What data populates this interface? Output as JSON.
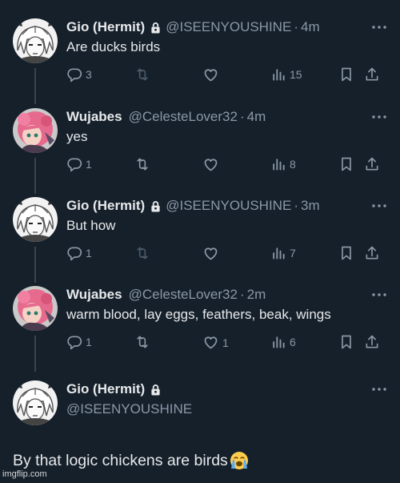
{
  "tweets": [
    {
      "name": "Gio (Hermit)",
      "locked": true,
      "handle": "@ISEENYOUSHINE",
      "time": "4m",
      "text": "Are ducks birds",
      "replies": "3",
      "retweets": "",
      "likes": "",
      "views": "15",
      "dim_retweet": true
    },
    {
      "name": "Wujabes",
      "locked": false,
      "handle": "@CelesteLover32",
      "time": "4m",
      "text": "yes",
      "replies": "1",
      "retweets": "",
      "likes": "",
      "views": "8",
      "dim_retweet": false
    },
    {
      "name": "Gio (Hermit)",
      "locked": true,
      "handle": "@ISEENYOUSHINE",
      "time": "3m",
      "text": "But how",
      "replies": "1",
      "retweets": "",
      "likes": "",
      "views": "7",
      "dim_retweet": true
    },
    {
      "name": "Wujabes",
      "locked": false,
      "handle": "@CelesteLover32",
      "time": "2m",
      "text": "warm blood, lay eggs, feathers, beak, wings",
      "replies": "1",
      "retweets": "",
      "likes": "1",
      "views": "6",
      "dim_retweet": false
    }
  ],
  "main_tweet": {
    "name": "Gio (Hermit)",
    "handle": "@ISEENYOUSHINE",
    "text": "By that logic chickens are birds"
  },
  "watermark": "imgflip.com",
  "colors": {
    "background": "#15202b",
    "text": "#e7e9ea",
    "secondary": "#8b98a5",
    "thread_line": "#38444d"
  },
  "icons": [
    "reply-icon",
    "retweet-icon",
    "like-icon",
    "views-icon",
    "bookmark-icon",
    "share-icon",
    "lock-icon",
    "more-icon",
    "crying-face-emoji"
  ]
}
